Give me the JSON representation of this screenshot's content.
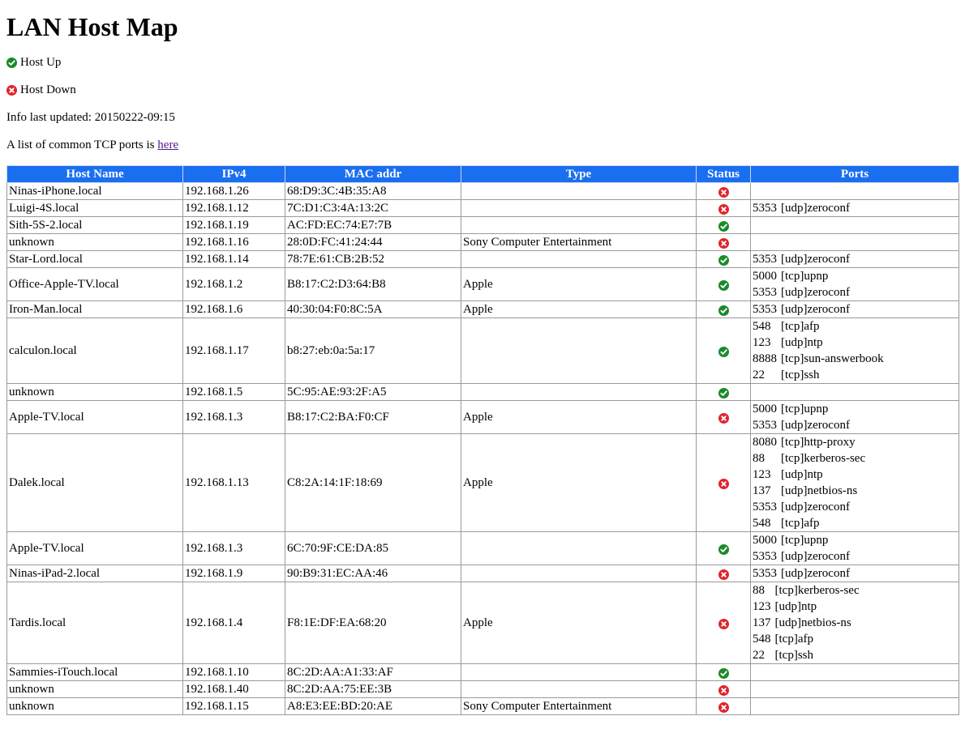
{
  "title": "LAN Host Map",
  "legend": {
    "up_label": "Host Up",
    "down_label": "Host Down"
  },
  "updated_text": "Info last updated: 20150222-09:15",
  "tcp_text": "A list of common TCP ports is ",
  "tcp_link": "here",
  "colors": {
    "header_bg": "#1a6ff0",
    "up": "#1a8a2a",
    "down": "#e0242c",
    "link": "#551a8b"
  },
  "icons": {
    "up": "check-circle-icon",
    "down": "x-circle-icon"
  },
  "table": {
    "headers": [
      "Host Name",
      "IPv4",
      "MAC addr",
      "Type",
      "Status",
      "Ports"
    ],
    "rows": [
      {
        "host": "Ninas-iPhone.local",
        "ip": "192.168.1.26",
        "mac": "68:D9:3C:4B:35:A8",
        "type": "",
        "status": "down",
        "ports": []
      },
      {
        "host": "Luigi-4S.local",
        "ip": "192.168.1.12",
        "mac": "7C:D1:C3:4A:13:2C",
        "type": "",
        "status": "down",
        "ports": [
          [
            "5353",
            "[udp]zeroconf"
          ]
        ]
      },
      {
        "host": "Sith-5S-2.local",
        "ip": "192.168.1.19",
        "mac": "AC:FD:EC:74:E7:7B",
        "type": "",
        "status": "up",
        "ports": []
      },
      {
        "host": "unknown",
        "ip": "192.168.1.16",
        "mac": "28:0D:FC:41:24:44",
        "type": "Sony Computer Entertainment",
        "status": "down",
        "ports": []
      },
      {
        "host": "Star-Lord.local",
        "ip": "192.168.1.14",
        "mac": "78:7E:61:CB:2B:52",
        "type": "",
        "status": "up",
        "ports": [
          [
            "5353",
            "[udp]zeroconf"
          ]
        ]
      },
      {
        "host": "Office-Apple-TV.local",
        "ip": "192.168.1.2",
        "mac": "B8:17:C2:D3:64:B8",
        "type": "Apple",
        "status": "up",
        "ports": [
          [
            "5000",
            "[tcp]upnp"
          ],
          [
            "5353",
            "[udp]zeroconf"
          ]
        ]
      },
      {
        "host": "Iron-Man.local",
        "ip": "192.168.1.6",
        "mac": "40:30:04:F0:8C:5A",
        "type": "Apple",
        "status": "up",
        "ports": [
          [
            "5353",
            "[udp]zeroconf"
          ]
        ]
      },
      {
        "host": "calculon.local",
        "ip": "192.168.1.17",
        "mac": "b8:27:eb:0a:5a:17",
        "type": "",
        "status": "up",
        "ports": [
          [
            "548",
            "[tcp]afp"
          ],
          [
            "123",
            "[udp]ntp"
          ],
          [
            "8888",
            "[tcp]sun-answerbook"
          ],
          [
            "22",
            "[tcp]ssh"
          ]
        ]
      },
      {
        "host": "unknown",
        "ip": "192.168.1.5",
        "mac": "5C:95:AE:93:2F:A5",
        "type": "",
        "status": "up",
        "ports": []
      },
      {
        "host": "Apple-TV.local",
        "ip": "192.168.1.3",
        "mac": "B8:17:C2:BA:F0:CF",
        "type": "Apple",
        "status": "down",
        "ports": [
          [
            "5000",
            "[tcp]upnp"
          ],
          [
            "5353",
            "[udp]zeroconf"
          ]
        ]
      },
      {
        "host": "Dalek.local",
        "ip": "192.168.1.13",
        "mac": "C8:2A:14:1F:18:69",
        "type": "Apple",
        "status": "down",
        "ports": [
          [
            "8080",
            "[tcp]http-proxy"
          ],
          [
            "88",
            "[tcp]kerberos-sec"
          ],
          [
            "123",
            "[udp]ntp"
          ],
          [
            "137",
            "[udp]netbios-ns"
          ],
          [
            "5353",
            "[udp]zeroconf"
          ],
          [
            "548",
            "[tcp]afp"
          ]
        ]
      },
      {
        "host": "Apple-TV.local",
        "ip": "192.168.1.3",
        "mac": "6C:70:9F:CE:DA:85",
        "type": "",
        "status": "up",
        "ports": [
          [
            "5000",
            "[tcp]upnp"
          ],
          [
            "5353",
            "[udp]zeroconf"
          ]
        ]
      },
      {
        "host": "Ninas-iPad-2.local",
        "ip": "192.168.1.9",
        "mac": "90:B9:31:EC:AA:46",
        "type": "",
        "status": "down",
        "ports": [
          [
            "5353",
            "[udp]zeroconf"
          ]
        ]
      },
      {
        "host": "Tardis.local",
        "ip": "192.168.1.4",
        "mac": "F8:1E:DF:EA:68:20",
        "type": "Apple",
        "status": "down",
        "ports": [
          [
            "88",
            "[tcp]kerberos-sec"
          ],
          [
            "123",
            "[udp]ntp"
          ],
          [
            "137",
            "[udp]netbios-ns"
          ],
          [
            "548",
            "[tcp]afp"
          ],
          [
            "22",
            "[tcp]ssh"
          ]
        ]
      },
      {
        "host": "Sammies-iTouch.local",
        "ip": "192.168.1.10",
        "mac": "8C:2D:AA:A1:33:AF",
        "type": "",
        "status": "up",
        "ports": []
      },
      {
        "host": "unknown",
        "ip": "192.168.1.40",
        "mac": "8C:2D:AA:75:EE:3B",
        "type": "",
        "status": "down",
        "ports": []
      },
      {
        "host": "unknown",
        "ip": "192.168.1.15",
        "mac": "A8:E3:EE:BD:20:AE",
        "type": "Sony Computer Entertainment",
        "status": "down",
        "ports": []
      }
    ]
  }
}
